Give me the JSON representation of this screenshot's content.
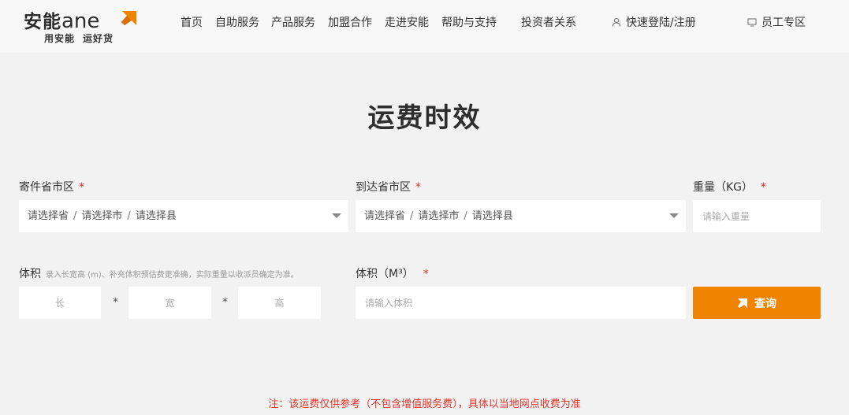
{
  "brand": {
    "name_cn": "安能",
    "name_latin": "ane",
    "slogan_left": "用安能",
    "slogan_right": "运好货",
    "accent_color": "#f08300"
  },
  "nav": {
    "items": [
      "首页",
      "自助服务",
      "产品服务",
      "加盟合作",
      "走进安能",
      "帮助与支持",
      "投资者关系"
    ],
    "login": {
      "icon": "user-icon",
      "label": "快速登陆/注册"
    },
    "staff": {
      "icon": "monitor-icon",
      "label": "员工专区"
    }
  },
  "page": {
    "title": "运费时效"
  },
  "form": {
    "sender": {
      "label": "寄件省市区",
      "required_mark": "*",
      "province": "请选择省",
      "city": "请选择市",
      "county": "请选择县",
      "separator": "/"
    },
    "receiver": {
      "label": "到达省市区",
      "required_mark": "*",
      "province": "请选择省",
      "city": "请选择市",
      "county": "请选择县",
      "separator": "/"
    },
    "weight": {
      "label": "重量（KG）",
      "required_mark": "*",
      "placeholder": "请输入重量",
      "value": ""
    },
    "dimensions": {
      "label": "体积",
      "hint": "录入长宽高 (m)、补充体积预估费更准确，实际重量以收派员确定为准。",
      "length_placeholder": "长",
      "width_placeholder": "宽",
      "height_placeholder": "高",
      "times_symbol": "*"
    },
    "volume": {
      "label": "体积（M³）",
      "required_mark": "*",
      "placeholder": "请输入体积",
      "value": ""
    },
    "query_button": {
      "icon": "send-arrow-icon",
      "label": "查询"
    }
  },
  "footer_note": "注：该运费仅供参考（不包含增值服务费），具体以当地网点收费为准"
}
